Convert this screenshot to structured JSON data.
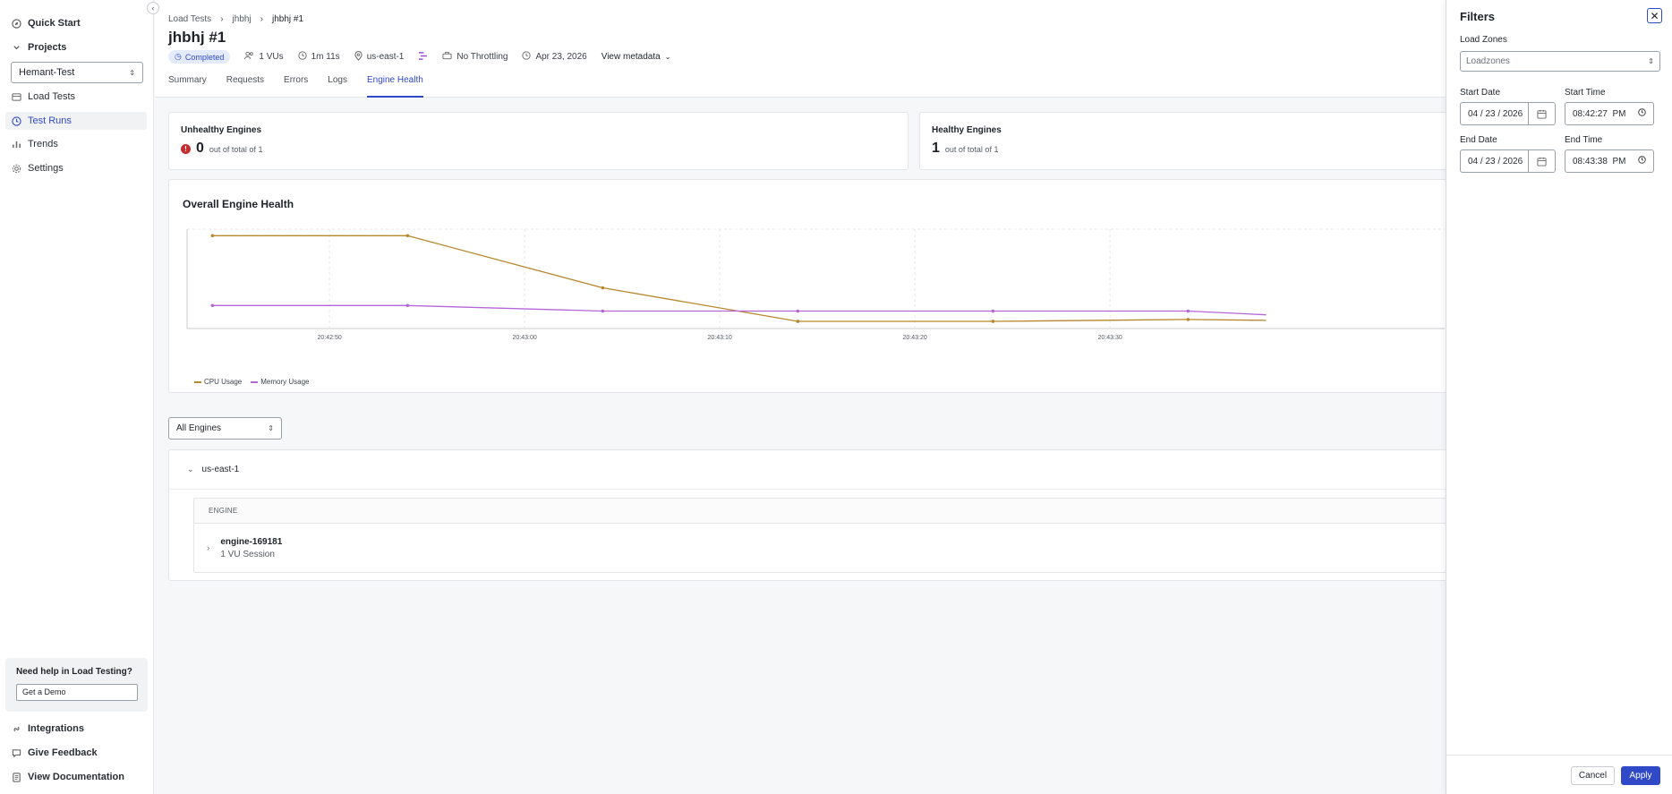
{
  "sidebar": {
    "quick_start": "Quick Start",
    "projects": "Projects",
    "project_selected": "Hemant-Test",
    "load_tests": "Load Tests",
    "test_runs": "Test Runs",
    "trends": "Trends",
    "settings": "Settings",
    "help_title": "Need help in Load Testing?",
    "demo_button": "Get a Demo",
    "integrations": "Integrations",
    "give_feedback": "Give Feedback",
    "view_documentation": "View Documentation"
  },
  "header": {
    "breadcrumbs": [
      "Load Tests",
      "jhbhj",
      "jhbhj #1"
    ],
    "title": "jhbhj #1",
    "status": "Completed",
    "vus": "1 VUs",
    "duration": "1m 11s",
    "region": "us-east-1",
    "throttling": "No Throttling",
    "date": "Apr 23, 2026",
    "view_metadata": "View metadata",
    "tabs": [
      "Summary",
      "Requests",
      "Errors",
      "Logs",
      "Engine Health"
    ],
    "active_tab": "Engine Health"
  },
  "stats": {
    "unhealthy_title": "Unhealthy Engines",
    "unhealthy_value": "0",
    "unhealthy_sub": "out of total of 1",
    "healthy_title": "Healthy Engines",
    "healthy_value": "1",
    "healthy_sub": "out of total of 1"
  },
  "chart_data": {
    "type": "line",
    "title": "Overall Engine Health",
    "x": [
      "20:42:44",
      "20:42:54",
      "20:43:04",
      "20:43:14",
      "20:43:24",
      "20:43:34",
      "20:43:38"
    ],
    "x_ticks": [
      "20:42:50",
      "20:43:00",
      "20:43:10",
      "20:43:20",
      "20:43:30"
    ],
    "series": [
      {
        "name": "CPU Usage",
        "color": "#b8862b",
        "values": [
          93,
          93,
          37,
          1,
          1,
          3,
          2
        ]
      },
      {
        "name": "Memory Usage",
        "color": "#b566d6",
        "values": [
          18,
          18,
          12,
          12,
          12,
          12,
          8
        ]
      }
    ],
    "ylim": [
      0,
      100
    ],
    "grid": true,
    "legend": "bottom-left"
  },
  "engines": {
    "filter": "All Engines",
    "region": "us-east-1",
    "column_header": "ENGINE",
    "rows": [
      {
        "name": "engine-169181",
        "sub": "1 VU Session"
      }
    ]
  },
  "filters": {
    "title": "Filters",
    "load_zones_label": "Load Zones",
    "load_zones_placeholder": "Loadzones",
    "start_date_label": "Start Date",
    "start_date": "04 / 23 / 2026",
    "start_time_label": "Start Time",
    "start_time": "08:42:27  PM",
    "end_date_label": "End Date",
    "end_date": "04 / 23 / 2026",
    "end_time_label": "End Time",
    "end_time": "08:43:38  PM",
    "cancel": "Cancel",
    "apply": "Apply"
  }
}
